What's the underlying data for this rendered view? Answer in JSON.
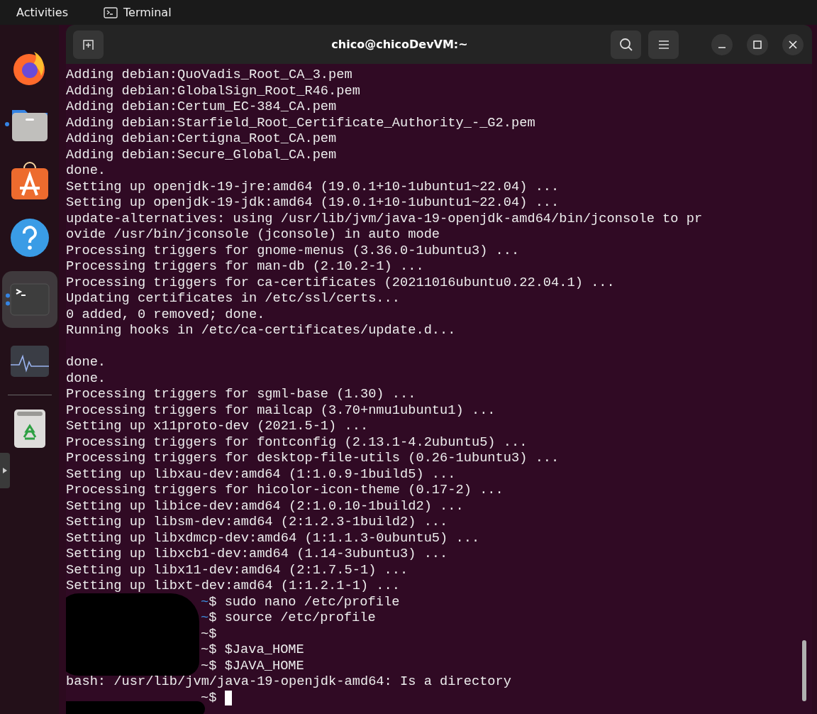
{
  "top_bar": {
    "activities": "Activities",
    "app_name": "Terminal"
  },
  "dock": {
    "items": [
      {
        "kind": "firefox",
        "running": false,
        "focused": false
      },
      {
        "kind": "files",
        "running": true,
        "focused": false
      },
      {
        "kind": "appcenter",
        "running": false,
        "focused": false
      },
      {
        "kind": "help",
        "running": false,
        "focused": false
      },
      {
        "kind": "terminal",
        "running": true,
        "focused": true
      },
      {
        "kind": "monitor",
        "running": false,
        "focused": false
      },
      {
        "kind": "separator"
      },
      {
        "kind": "trash",
        "running": false,
        "focused": false
      }
    ]
  },
  "window": {
    "title": "chico@chicoDevVM:~"
  },
  "terminal": {
    "lines": [
      {
        "kind": "output",
        "text": "Adding debian:QuoVadis_Root_CA_3.pem"
      },
      {
        "kind": "output",
        "text": "Adding debian:GlobalSign_Root_R46.pem"
      },
      {
        "kind": "output",
        "text": "Adding debian:Certum_EC-384_CA.pem"
      },
      {
        "kind": "output",
        "text": "Adding debian:Starfield_Root_Certificate_Authority_-_G2.pem"
      },
      {
        "kind": "output",
        "text": "Adding debian:Certigna_Root_CA.pem"
      },
      {
        "kind": "output",
        "text": "Adding debian:Secure_Global_CA.pem"
      },
      {
        "kind": "output",
        "text": "done."
      },
      {
        "kind": "output",
        "text": "Setting up openjdk-19-jre:amd64 (19.0.1+10-1ubuntu1~22.04) ..."
      },
      {
        "kind": "output",
        "text": "Setting up openjdk-19-jdk:amd64 (19.0.1+10-1ubuntu1~22.04) ..."
      },
      {
        "kind": "output",
        "text": "update-alternatives: using /usr/lib/jvm/java-19-openjdk-amd64/bin/jconsole to pr"
      },
      {
        "kind": "output",
        "text": "ovide /usr/bin/jconsole (jconsole) in auto mode"
      },
      {
        "kind": "output",
        "text": "Processing triggers for gnome-menus (3.36.0-1ubuntu3) ..."
      },
      {
        "kind": "output",
        "text": "Processing triggers for man-db (2.10.2-1) ..."
      },
      {
        "kind": "output",
        "text": "Processing triggers for ca-certificates (20211016ubuntu0.22.04.1) ..."
      },
      {
        "kind": "output",
        "text": "Updating certificates in /etc/ssl/certs..."
      },
      {
        "kind": "output",
        "text": "0 added, 0 removed; done."
      },
      {
        "kind": "output",
        "text": "Running hooks in /etc/ca-certificates/update.d..."
      },
      {
        "kind": "blank"
      },
      {
        "kind": "output",
        "text": "done."
      },
      {
        "kind": "output",
        "text": "done."
      },
      {
        "kind": "output",
        "text": "Processing triggers for sgml-base (1.30) ..."
      },
      {
        "kind": "output",
        "text": "Processing triggers for mailcap (3.70+nmu1ubuntu1) ..."
      },
      {
        "kind": "output",
        "text": "Setting up x11proto-dev (2021.5-1) ..."
      },
      {
        "kind": "output",
        "text": "Processing triggers for fontconfig (2.13.1-4.2ubuntu5) ..."
      },
      {
        "kind": "output",
        "text": "Processing triggers for desktop-file-utils (0.26-1ubuntu3) ..."
      },
      {
        "kind": "output",
        "text": "Setting up libxau-dev:amd64 (1:1.0.9-1build5) ..."
      },
      {
        "kind": "output",
        "text": "Processing triggers for hicolor-icon-theme (0.17-2) ..."
      },
      {
        "kind": "output",
        "text": "Setting up libice-dev:amd64 (2:1.0.10-1build2) ..."
      },
      {
        "kind": "output",
        "text": "Setting up libsm-dev:amd64 (2:1.2.3-1build2) ..."
      },
      {
        "kind": "output",
        "text": "Setting up libxdmcp-dev:amd64 (1:1.1.3-0ubuntu5) ..."
      },
      {
        "kind": "output",
        "text": "Setting up libxcb1-dev:amd64 (1.14-3ubuntu3) ..."
      },
      {
        "kind": "output",
        "text": "Setting up libx11-dev:amd64 (2:1.7.5-1) ..."
      },
      {
        "kind": "output",
        "text": "Setting up libxt-dev:amd64 (1:1.2.1-1) ..."
      },
      {
        "kind": "prompt",
        "path": "~",
        "symbol": "$",
        "command": "sudo nano /etc/profile",
        "colored": true
      },
      {
        "kind": "prompt",
        "path": "~",
        "symbol": "$",
        "command": "source /etc/profile",
        "colored": true
      },
      {
        "kind": "prompt",
        "path": "~",
        "symbol": "$",
        "colored": false
      },
      {
        "kind": "prompt",
        "path": "~",
        "symbol": "$",
        "command": "$Java_HOME",
        "colored": false
      },
      {
        "kind": "prompt",
        "path": "~",
        "symbol": "$",
        "command": "$JAVA_HOME",
        "colored": false
      },
      {
        "kind": "output",
        "text": "bash: /usr/lib/jvm/java-19-openjdk-amd64: Is a directory"
      },
      {
        "kind": "prompt",
        "path": "~",
        "symbol": "$",
        "colored": false,
        "cursor": true
      }
    ]
  }
}
